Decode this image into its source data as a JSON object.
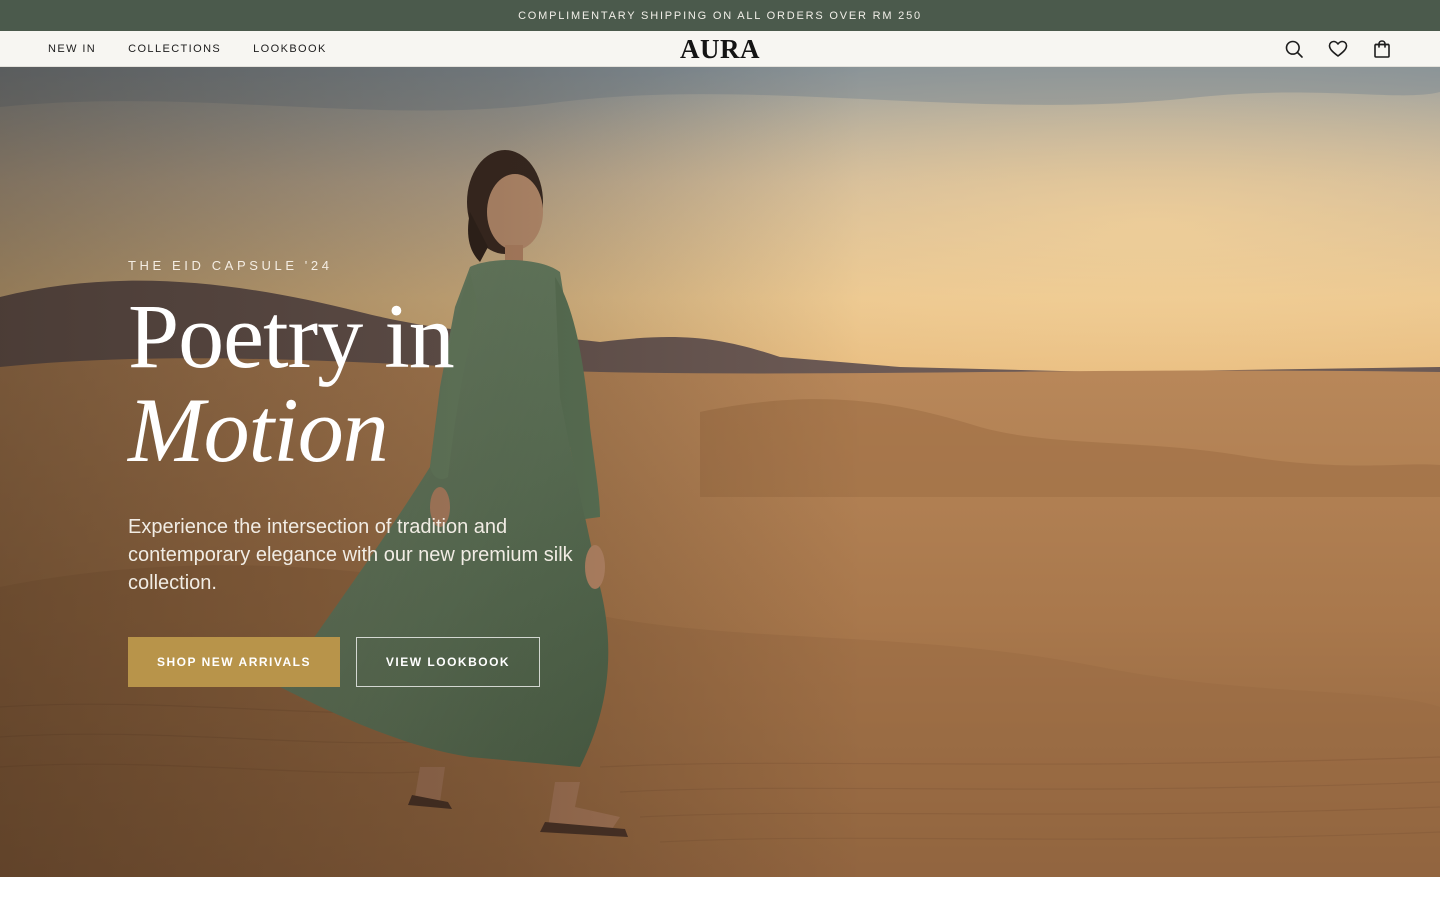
{
  "announcement": {
    "text": "COMPLIMENTARY SHIPPING ON ALL ORDERS OVER RM 250"
  },
  "nav": {
    "links": [
      {
        "label": "NEW IN"
      },
      {
        "label": "COLLECTIONS"
      },
      {
        "label": "LOOKBOOK"
      }
    ],
    "logo": "AURA",
    "icons": [
      "search-icon",
      "heart-icon",
      "shopping-bag-icon"
    ]
  },
  "hero": {
    "eyebrow": "THE EID CAPSULE '24",
    "title_line1": "Poetry in",
    "title_line2": "Motion",
    "description": "Experience the intersection of tradition and contemporary elegance with our new premium silk collection.",
    "primary_cta": "SHOP NEW ARRIVALS",
    "secondary_cta": "VIEW LOOKBOOK"
  },
  "colors": {
    "announcement_bg": "#4b5a4c",
    "nav_bg": "#f7f6f2",
    "accent_gold": "#b8944a",
    "dress_green": "#6e8a6a",
    "sand": "#b8875a"
  }
}
